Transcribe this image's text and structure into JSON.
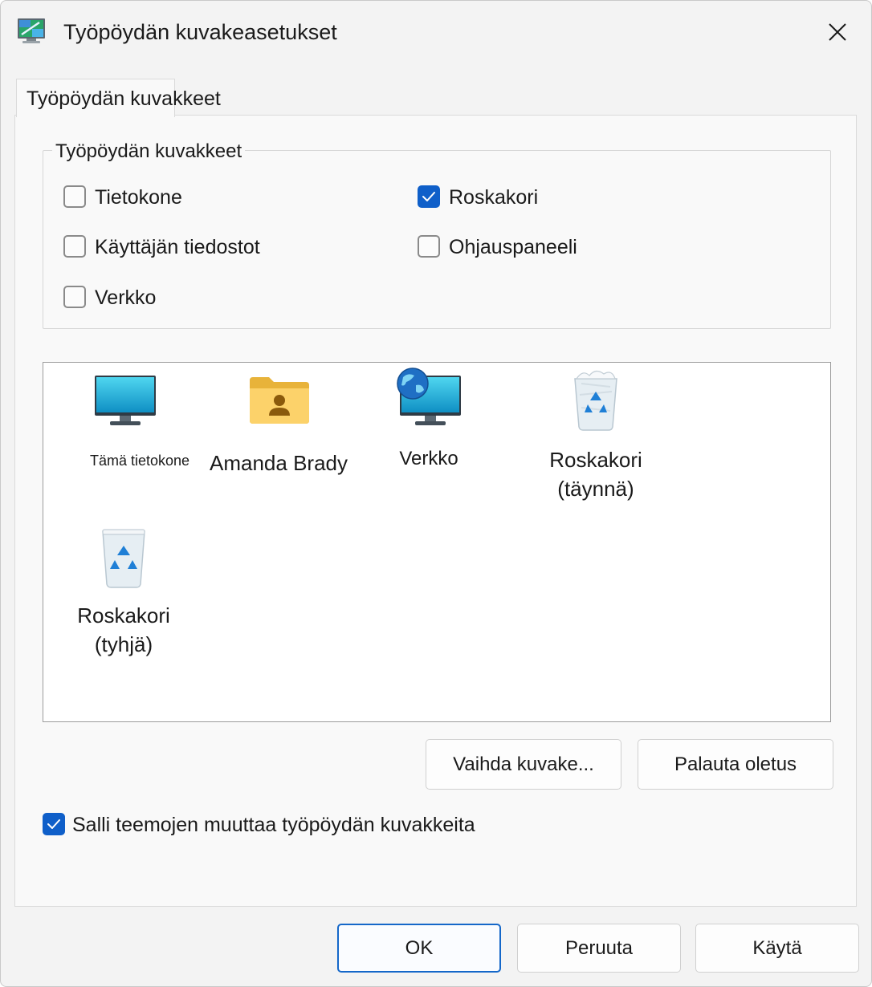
{
  "window": {
    "title": "Työpöydän kuvakeasetukset",
    "app_icon": "display-settings-icon",
    "close_icon": "close-icon"
  },
  "tabs": [
    {
      "label": "Työpöydän kuvakkeet",
      "selected": true
    }
  ],
  "desktop_icons_group": {
    "legend": "Työpöydän kuvakkeet",
    "checkboxes": [
      {
        "label": "Tietokone",
        "checked": false
      },
      {
        "label": "Roskakori",
        "checked": true
      },
      {
        "label": "Käyttäjän tiedostot",
        "checked": false
      },
      {
        "label": "Ohjauspaneeli",
        "checked": false
      },
      {
        "label": "Verkko",
        "checked": false
      }
    ]
  },
  "icon_list": [
    {
      "label": "Tämä tietokone",
      "icon": "monitor-icon"
    },
    {
      "label": "Amanda Brady",
      "icon": "user-folder-icon"
    },
    {
      "label": "Verkko",
      "icon": "network-globe-icon"
    },
    {
      "label_line1": "Roskakori",
      "label_line2": "(täynnä)",
      "icon": "recycle-bin-full-icon"
    },
    {
      "label_line1": "Roskakori",
      "label_line2": "(tyhjä)",
      "icon": "recycle-bin-empty-icon"
    }
  ],
  "buttons": {
    "change_icon": "Vaihda kuvake...",
    "restore_default": "Palauta oletus",
    "ok": "OK",
    "cancel": "Peruuta",
    "apply": "Käytä"
  },
  "allow_themes": {
    "label": "Salli teemojen muuttaa työpöydän kuvakkeita",
    "checked": true
  },
  "colors": {
    "accent": "#0f5fc9",
    "window_background": "#f3f3f3",
    "panel_background": "#f9f9f9"
  }
}
